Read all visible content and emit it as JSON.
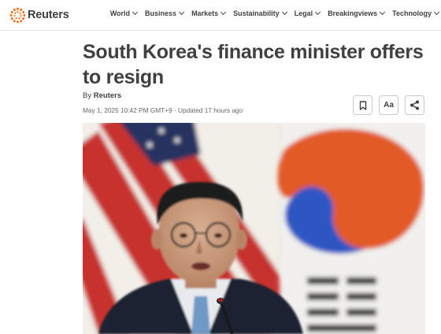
{
  "brand": {
    "name": "Reuters",
    "accent": "#fa6400"
  },
  "nav": {
    "items": [
      {
        "label": "World"
      },
      {
        "label": "Business"
      },
      {
        "label": "Markets"
      },
      {
        "label": "Sustainability"
      },
      {
        "label": "Legal"
      },
      {
        "label": "Breakingviews"
      },
      {
        "label": "Technology"
      }
    ]
  },
  "article": {
    "headline": "South Korea's finance minister offers to resign",
    "byline_prefix": "By",
    "author": "Reuters",
    "dateline": "May 1, 2025 10:42 PM GMT+9 · Updated 17 hours ago"
  },
  "actions": {
    "save_icon": "bookmark-icon",
    "text_size_label": "Aa",
    "share_icon": "share-icon"
  },
  "photo": {
    "subject": "man in dark suit with glasses speaking at microphone, US and South Korean flags behind"
  }
}
